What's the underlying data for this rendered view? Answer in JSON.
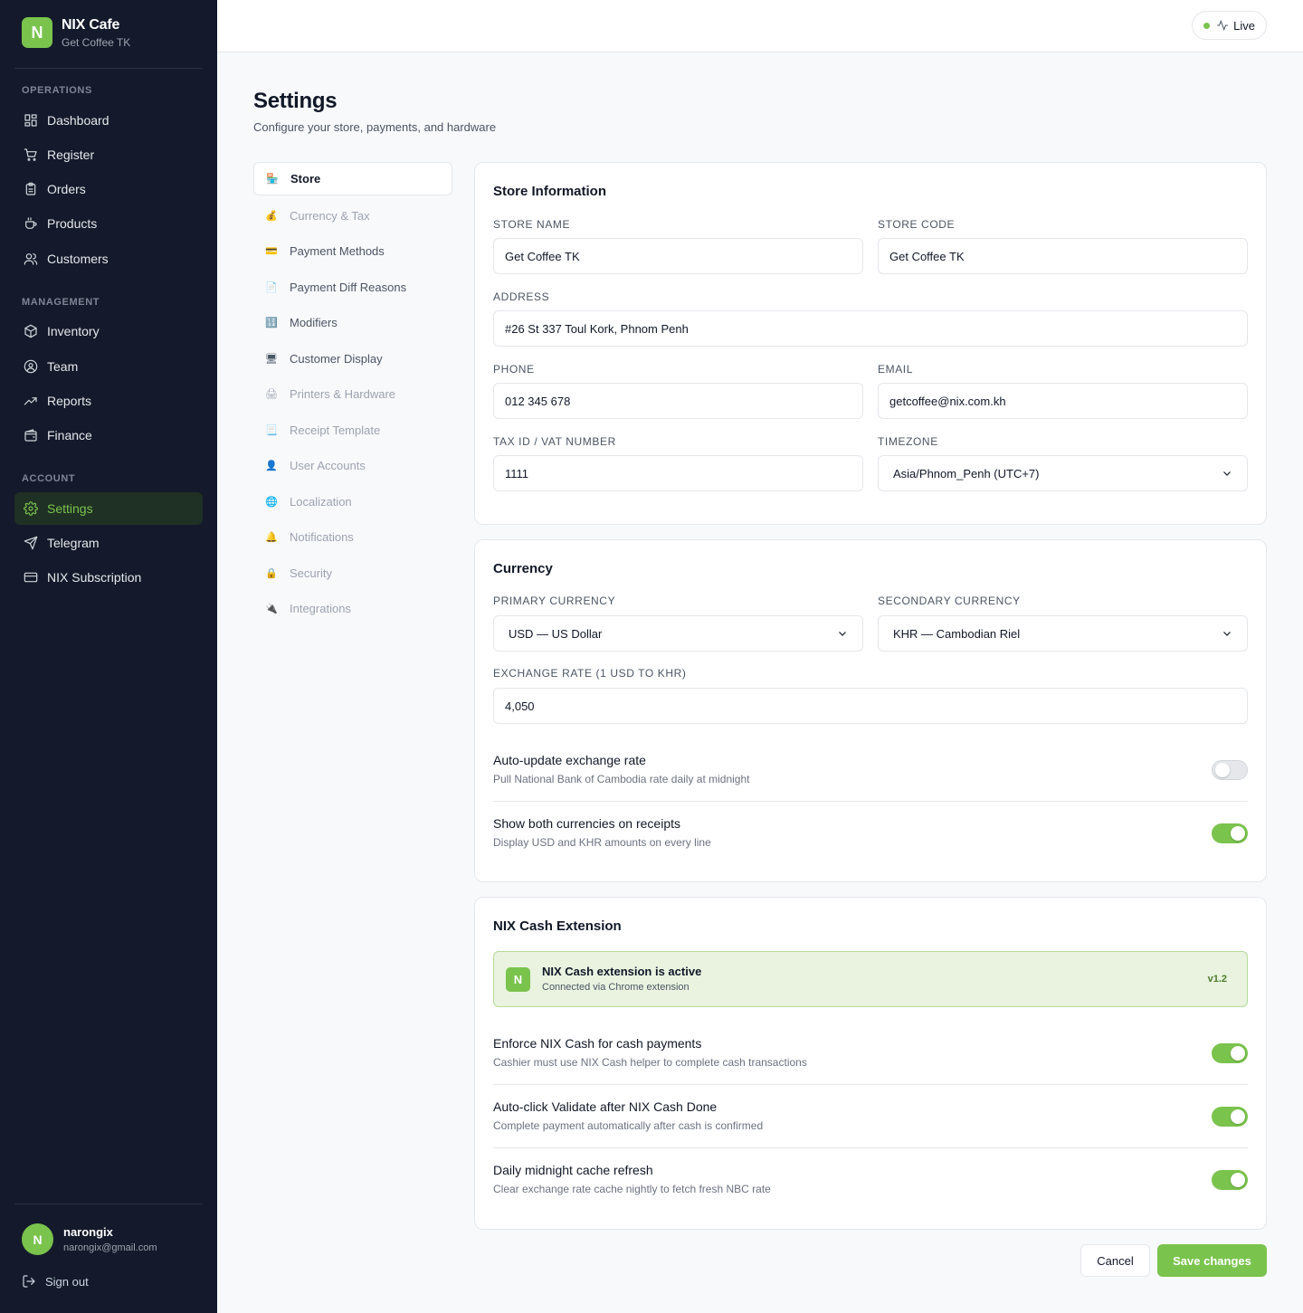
{
  "brand": {
    "logo_letter": "N",
    "name": "NIX Cafe",
    "store": "Get Coffee TK"
  },
  "sidebar": {
    "sections": [
      {
        "label": "OPERATIONS",
        "items": [
          {
            "label": "Dashboard",
            "icon": "grid-icon"
          },
          {
            "label": "Register",
            "icon": "cart-icon"
          },
          {
            "label": "Orders",
            "icon": "clipboard-icon"
          },
          {
            "label": "Products",
            "icon": "coffee-icon"
          },
          {
            "label": "Customers",
            "icon": "users-icon"
          }
        ]
      },
      {
        "label": "MANAGEMENT",
        "items": [
          {
            "label": "Inventory",
            "icon": "box-icon"
          },
          {
            "label": "Team",
            "icon": "user-circle-icon"
          },
          {
            "label": "Reports",
            "icon": "trend-icon"
          },
          {
            "label": "Finance",
            "icon": "wallet-icon"
          }
        ]
      },
      {
        "label": "ACCOUNT",
        "items": [
          {
            "label": "Settings",
            "icon": "gear-icon",
            "active": true
          },
          {
            "label": "Telegram",
            "icon": "send-icon"
          },
          {
            "label": "NIX Subscription",
            "icon": "card-icon"
          }
        ]
      }
    ],
    "user": {
      "initial": "N",
      "name": "narongix",
      "email": "narongix@gmail.com"
    },
    "signout_label": "Sign out"
  },
  "topbar": {
    "status_label": "Live"
  },
  "page": {
    "title": "Settings",
    "subtitle": "Configure your store, payments, and hardware"
  },
  "settings_nav": [
    {
      "label": "Store",
      "icon": "🏪",
      "active": true
    },
    {
      "label": "Currency & Tax",
      "icon": "💰"
    },
    {
      "label": "Payment Methods",
      "icon": "💳"
    },
    {
      "label": "Payment Diff Reasons",
      "icon": "📄"
    },
    {
      "label": "Modifiers",
      "icon": "🔢"
    },
    {
      "label": "Customer Display",
      "icon": "🖥"
    },
    {
      "label": "Printers & Hardware",
      "icon": "🖨"
    },
    {
      "label": "Receipt Template",
      "icon": "📃"
    },
    {
      "label": "User Accounts",
      "icon": "👤"
    },
    {
      "label": "Localization",
      "icon": "🌐"
    },
    {
      "label": "Notifications",
      "icon": "🔔"
    },
    {
      "label": "Security",
      "icon": "🔒"
    },
    {
      "label": "Integrations",
      "icon": "🔌"
    }
  ],
  "store_info": {
    "title": "Store Information",
    "store_name": {
      "label": "STORE NAME",
      "value": "Get Coffee TK"
    },
    "store_code": {
      "label": "STORE CODE",
      "value": "Get Coffee TK"
    },
    "address": {
      "label": "ADDRESS",
      "value": "#26 St 337 Toul Kork, Phnom Penh"
    },
    "phone": {
      "label": "PHONE",
      "value": "012 345 678"
    },
    "email": {
      "label": "EMAIL",
      "value": "getcoffee@nix.com.kh"
    },
    "tax_id": {
      "label": "TAX ID / VAT NUMBER",
      "value": "1111"
    },
    "timezone": {
      "label": "TIMEZONE",
      "value": "Asia/Phnom_Penh (UTC+7)"
    }
  },
  "currency": {
    "title": "Currency",
    "primary": {
      "label": "PRIMARY CURRENCY",
      "value": "USD — US Dollar"
    },
    "secondary": {
      "label": "SECONDARY CURRENCY",
      "value": "KHR — Cambodian Riel"
    },
    "exchange_rate": {
      "label": "EXCHANGE RATE (1 USD TO KHR)",
      "value": "4,050"
    },
    "auto_update": {
      "title": "Auto-update exchange rate",
      "desc": "Pull National Bank of Cambodia rate daily at midnight",
      "enabled": false
    },
    "show_both": {
      "title": "Show both currencies on receipts",
      "desc": "Display USD and KHR amounts on every line",
      "enabled": true
    }
  },
  "nix_cash": {
    "title": "NIX Cash Extension",
    "banner": {
      "logo_letter": "N",
      "title": "NIX Cash extension is active",
      "subtitle": "Connected via Chrome extension",
      "version": "v1.2"
    },
    "enforce": {
      "title": "Enforce NIX Cash for cash payments",
      "desc": "Cashier must use NIX Cash helper to complete cash transactions",
      "enabled": true
    },
    "auto_validate": {
      "title": "Auto-click Validate after NIX Cash Done",
      "desc": "Complete payment automatically after cash is confirmed",
      "enabled": true
    },
    "cache_refresh": {
      "title": "Daily midnight cache refresh",
      "desc": "Clear exchange rate cache nightly to fetch fresh NBC rate",
      "enabled": true
    }
  },
  "actions": {
    "cancel_label": "Cancel",
    "save_label": "Save changes"
  },
  "colors": {
    "accent": "#7ac34d",
    "sidebar_bg": "#141a2b"
  }
}
